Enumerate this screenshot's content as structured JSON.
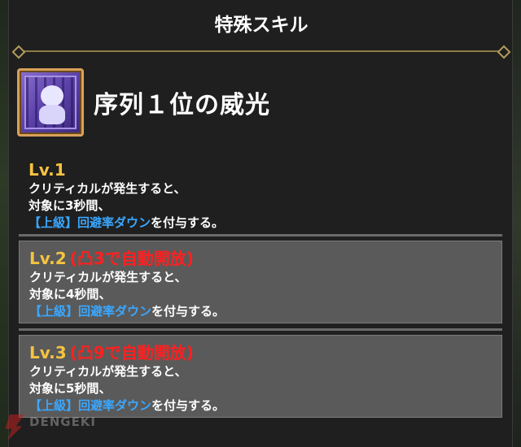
{
  "header": {
    "title": "特殊スキル"
  },
  "skill": {
    "name": "序列１位の威光",
    "icon": "skill-icon-purple-figure"
  },
  "levels": [
    {
      "label": "Lv.1",
      "unlock": "",
      "line1": "クリティカルが発生すると、",
      "line2": "対象に3秒間、",
      "keyword": "【上級】回避率ダウン",
      "suffix": "を付与する。"
    },
    {
      "label": "Lv.2",
      "unlock": "(凸3で自動開放)",
      "line1": "クリティカルが発生すると、",
      "line2": "対象に4秒間、",
      "keyword": "【上級】回避率ダウン",
      "suffix": "を付与する。"
    },
    {
      "label": "Lv.3",
      "unlock": "(凸9で自動開放)",
      "line1": "クリティカルが発生すると、",
      "line2": "対象に5秒間、",
      "keyword": "【上級】回避率ダウン",
      "suffix": "を付与する。"
    }
  ],
  "watermark": {
    "text": "DENGEKI",
    "icon": "dengeki-bolt-logo"
  },
  "colors": {
    "level_label": "#f5c341",
    "unlock_text": "#ff2020",
    "keyword_text": "#3aa7ff",
    "title_rule": "#8f7a45",
    "icon_frame": "#d8a15a"
  }
}
